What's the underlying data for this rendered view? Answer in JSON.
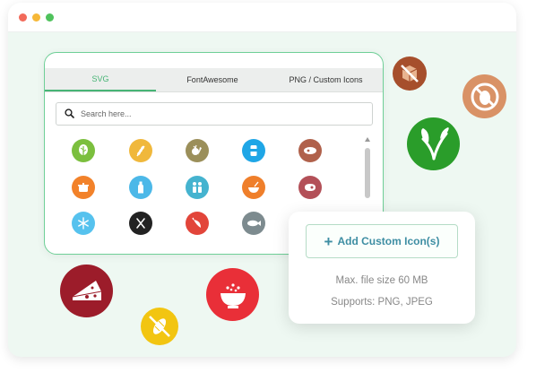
{
  "window": {
    "traffic_lights": [
      {
        "name": "close",
        "color": "#f26a5a"
      },
      {
        "name": "minimize",
        "color": "#f6b838"
      },
      {
        "name": "maximize",
        "color": "#4fc25c"
      }
    ]
  },
  "panel": {
    "tabs": [
      {
        "label": "SVG",
        "active": true
      },
      {
        "label": "FontAwesome",
        "active": false
      },
      {
        "label": "PNG / Custom Icons",
        "active": false
      }
    ],
    "search": {
      "placeholder": "Search here..."
    },
    "icons": [
      {
        "name": "lettuce-icon",
        "color": "#7bbf3e"
      },
      {
        "name": "wheat-icon",
        "color": "#f0b83c"
      },
      {
        "name": "vegetables-icon",
        "color": "#9b8f5a"
      },
      {
        "name": "drink-can-icon",
        "color": "#1fa6e6"
      },
      {
        "name": "ham-icon",
        "color": "#b0614b"
      },
      {
        "name": "pot-icon",
        "color": "#f2822a"
      },
      {
        "name": "milk-bottle-icon",
        "color": "#4cb8e8"
      },
      {
        "name": "family-icon",
        "color": "#45b3cf"
      },
      {
        "name": "bowl-icon",
        "color": "#ef7f2b"
      },
      {
        "name": "meat-icon",
        "color": "#b35058"
      },
      {
        "name": "snowflake-icon",
        "color": "#56c2ee"
      },
      {
        "name": "cutlery-icon",
        "color": "#222222"
      },
      {
        "name": "chili-icon",
        "color": "#e2453a"
      },
      {
        "name": "fish-icon",
        "color": "#7d8b8f"
      }
    ]
  },
  "upload": {
    "button_label": "Add Custom Icon(s)",
    "max_size": "Max. file size 60 MB",
    "supports": "Supports: PNG, JPEG"
  },
  "floating_icons": [
    {
      "name": "no-package-icon",
      "color": "#a64f2c"
    },
    {
      "name": "no-egg-icon",
      "color": "#d99266"
    },
    {
      "name": "vegan-leaf-icon",
      "color": "#2a9d2a"
    },
    {
      "name": "cheese-icon",
      "color": "#9c1c2a"
    },
    {
      "name": "noodle-bowl-icon",
      "color": "#e92f38"
    },
    {
      "name": "no-corn-icon",
      "color": "#f2c511"
    }
  ]
}
